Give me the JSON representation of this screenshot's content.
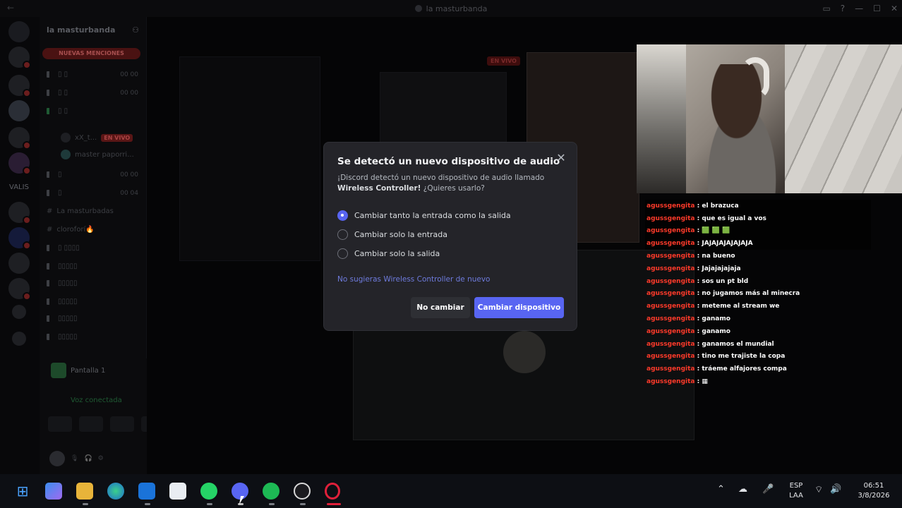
{
  "window": {
    "title": "la masturbanda"
  },
  "server_rail": {
    "label": "VALIS"
  },
  "channel_list": {
    "server_name": "la masturbanda",
    "mentions_label": "NUEVAS MENCIONES",
    "live_badge": "EN VIVO",
    "live_user": "xX_t...",
    "voice_user": "master paporri...",
    "text_channel_1": "La masturbadas",
    "text_channel_2": "cloroforí🔥",
    "screen_label": "Pantalla 1",
    "voice_status": "Voz conectada"
  },
  "stage": {
    "live_tag": "EN VIVO"
  },
  "modal": {
    "title": "Se detectó un nuevo dispositivo de audio",
    "desc_prefix": "¡Discord detectó un nuevo dispositivo de audio llamado",
    "device_name": "Wireless Controller!",
    "desc_suffix": "¿Quieres usarlo?",
    "options": [
      {
        "label": "Cambiar tanto la entrada como la salida",
        "selected": true
      },
      {
        "label": "Cambiar solo la entrada",
        "selected": false
      },
      {
        "label": "Cambiar solo la salida",
        "selected": false
      }
    ],
    "dont_suggest_link": "No sugieras Wireless Controller de nuevo",
    "cancel_label": "No cambiar",
    "confirm_label": "Cambiar dispositivo"
  },
  "chat": {
    "nick": "agussgengita",
    "messages": [
      "el brazuca",
      "que es igual a vos",
      "🟩 🟩 🟩",
      "JAJAJAJAJAJAJA",
      "na bueno",
      "Jajajajajaja",
      "sos un pt bld",
      "no jugamos más al minecra",
      "meteme al stream we",
      "ganamo",
      "ganamo",
      "ganamos el mundial",
      "tino me trajiste la copa",
      "tráeme alfajores compa",
      "▦"
    ]
  },
  "taskbar": {
    "language_top": "ESP",
    "language_bottom": "LAA",
    "time": "06:51",
    "date": "3/8/2026",
    "apps": [
      "start-icon",
      "widgets-icon",
      "file-explorer-icon",
      "edge-icon",
      "outlook-icon",
      "store-icon",
      "whatsapp-icon",
      "discord-icon",
      "spotify-icon",
      "obs-icon",
      "opera-icon"
    ]
  },
  "colors": {
    "accent": "#5865f2",
    "link": "#6e7bdc",
    "modal_bg": "#242429",
    "chat_nick": "#ff3a2a"
  }
}
